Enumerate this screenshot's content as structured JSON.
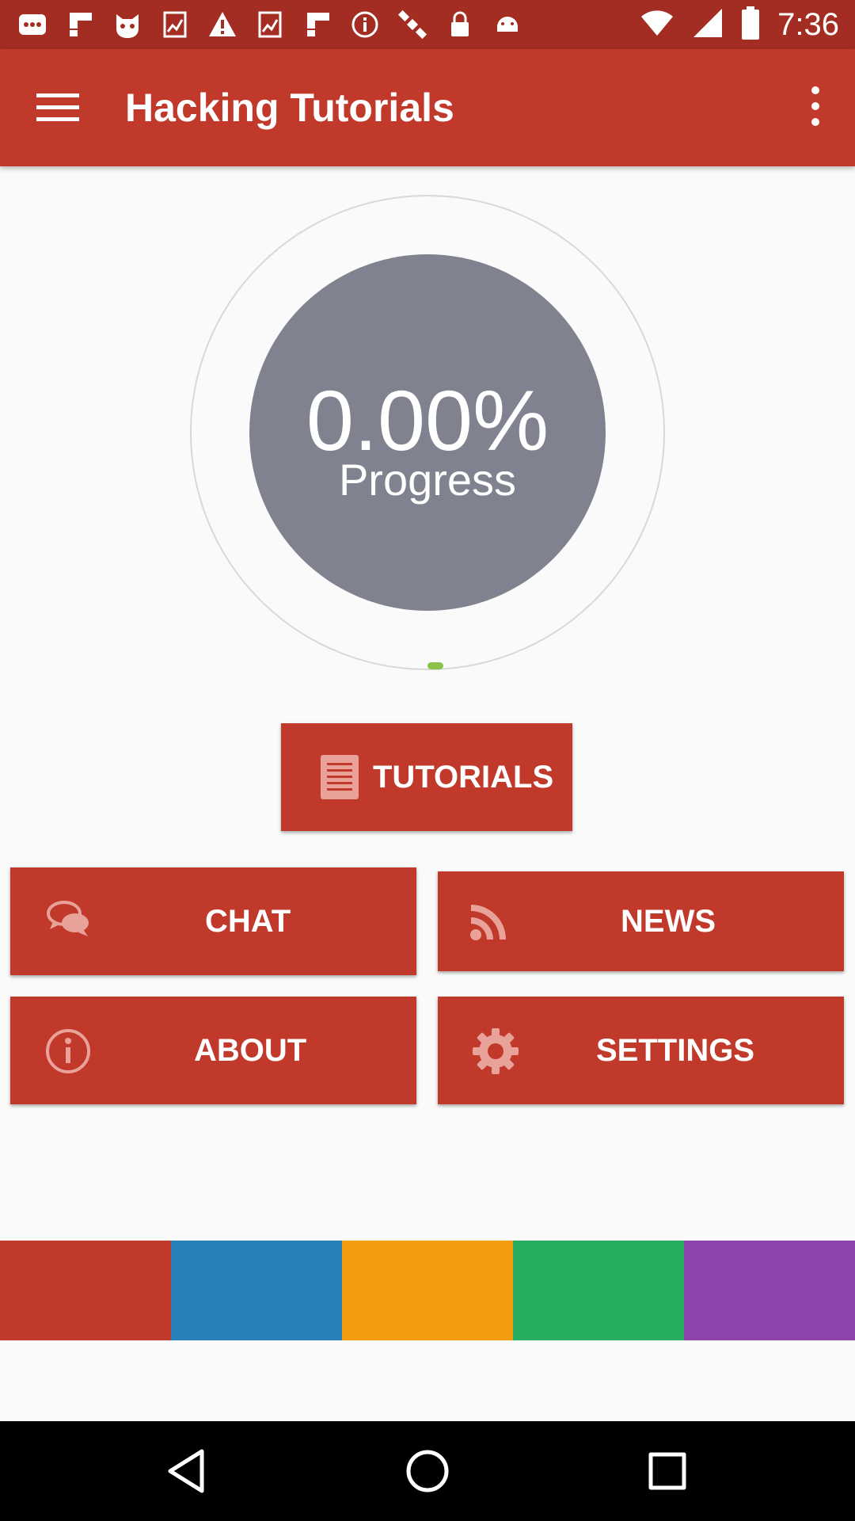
{
  "status_bar": {
    "time": "7:36",
    "icons": [
      "message-icon",
      "flipboard-icon",
      "cat-icon",
      "chart-icon",
      "warning-icon",
      "chart-icon",
      "flipboard-icon",
      "info-icon",
      "satellite-icon",
      "lock-icon",
      "android-icon"
    ],
    "right_icons": [
      "wifi-icon",
      "signal-icon",
      "battery-icon"
    ]
  },
  "app_bar": {
    "title": "Hacking Tutorials",
    "menu_icon": "hamburger-menu-icon",
    "overflow_icon": "more-vertical-icon"
  },
  "progress": {
    "value_text": "0.00%",
    "label": "Progress",
    "fraction": 0.0
  },
  "buttons": {
    "tutorials": "TUTORIALS",
    "chat": "CHAT",
    "news": "NEWS",
    "about": "ABOUT",
    "settings": "SETTINGS"
  },
  "colors": {
    "primary": "#c0392b",
    "status_bar": "#a32d22",
    "progress_inner": "#80828f",
    "progress_dot": "#8bc34a",
    "stripes": [
      "#c0392b",
      "#2980b9",
      "#f39c12",
      "#27ae60",
      "#8e44ad"
    ]
  },
  "nav_bar": [
    "back-icon",
    "home-icon",
    "recents-icon"
  ]
}
